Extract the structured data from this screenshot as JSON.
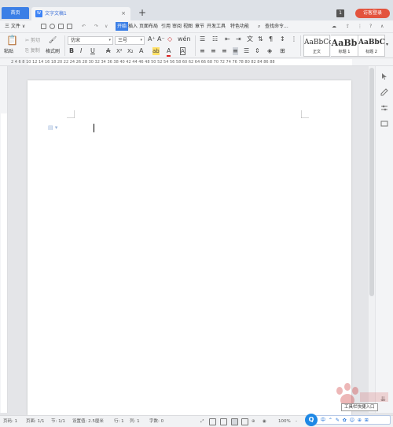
{
  "tabs": {
    "home": "首页",
    "doc": "文字文稿1",
    "doc_icon": "W",
    "close": "×",
    "add": "+"
  },
  "topright": {
    "badge": "1",
    "login": "访客登录"
  },
  "menu": {
    "file": "三 文件 ∨",
    "items": [
      "开始",
      "插入",
      "页面布局",
      "引用",
      "审阅",
      "视图",
      "章节",
      "开发工具",
      "特色功能"
    ],
    "search": "查找命令..."
  },
  "ribbon": {
    "paste": "粘贴",
    "cut": "剪切",
    "copy": "复制",
    "format_painter": "格式刷",
    "font_name": "仿宋",
    "font_size": "三号",
    "format_glyphs": [
      "B",
      "I",
      "U",
      "A",
      "X²",
      "X₂",
      "A",
      "ab",
      "A",
      "A"
    ],
    "styles": [
      {
        "sample": "AaBbCcI",
        "name": "正文"
      },
      {
        "sample": "AaBb",
        "name": "标题 1"
      },
      {
        "sample": "AaBbC",
        "name": "标题 2"
      }
    ]
  },
  "ruler": {
    "ticks": "2  4  6  8  10  12  14  16  18  20  22  24  26  28  30  32  34  36  38  40  42  44  46  48  50  52  54  56  58  60  62  64  66  68  70  72  74  76  78  80  82  84  86  88"
  },
  "status": {
    "page": "页码: 1",
    "pages": "页面: 1/1",
    "section": "节: 1/1",
    "setting": "设置值: 2.5厘米",
    "row": "行: 1",
    "col": "列: 1",
    "words": "字数: 0",
    "zoom": "100%",
    "zoom_minus": "-"
  },
  "floatbar": {
    "logo": "Q",
    "items": "中 ⌃ ✎ ✿ ☺ ⊕ ⊞",
    "tooltip": "工具栏快捷入口"
  }
}
